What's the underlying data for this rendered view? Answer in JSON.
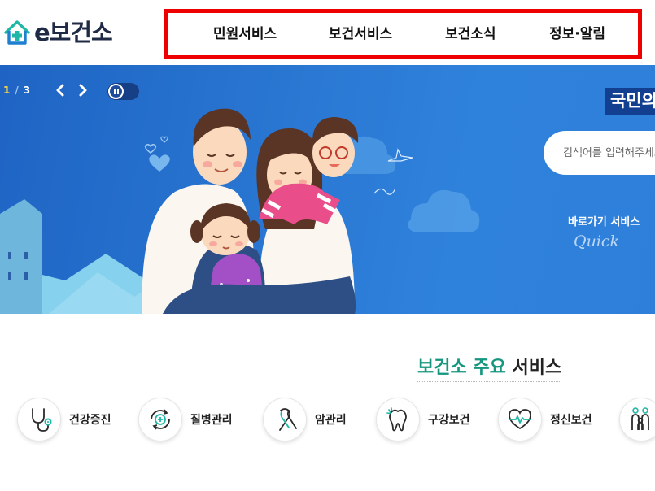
{
  "logo": {
    "text": "e보건소"
  },
  "nav": {
    "items": [
      {
        "label": "민원서비스"
      },
      {
        "label": "보건서비스"
      },
      {
        "label": "보건소식"
      },
      {
        "label": "정보·알림"
      }
    ]
  },
  "hero": {
    "slide_current": "1",
    "slide_separator": "/",
    "slide_total": "3",
    "headline": "국민의",
    "search": {
      "placeholder": "검색어를 입력해주세요"
    },
    "quick": {
      "title": "바로가기 서비스",
      "script": "Quick"
    }
  },
  "services": {
    "title_accent": "보건소 주요",
    "title_rest": "서비스",
    "items": [
      {
        "label": "건강증진",
        "icon": "stethoscope-icon"
      },
      {
        "label": "질병관리",
        "icon": "medical-cross-icon"
      },
      {
        "label": "암관리",
        "icon": "ribbon-icon"
      },
      {
        "label": "구강보건",
        "icon": "tooth-icon"
      },
      {
        "label": "정신보건",
        "icon": "heart-pulse-icon"
      },
      {
        "label": "",
        "icon": "family-icon"
      }
    ]
  },
  "colors": {
    "nav_highlight_border": "#ef0000",
    "hero_blue": "#2a78d3",
    "accent_green": "#14967f",
    "icon_teal": "#1fb7a6"
  }
}
